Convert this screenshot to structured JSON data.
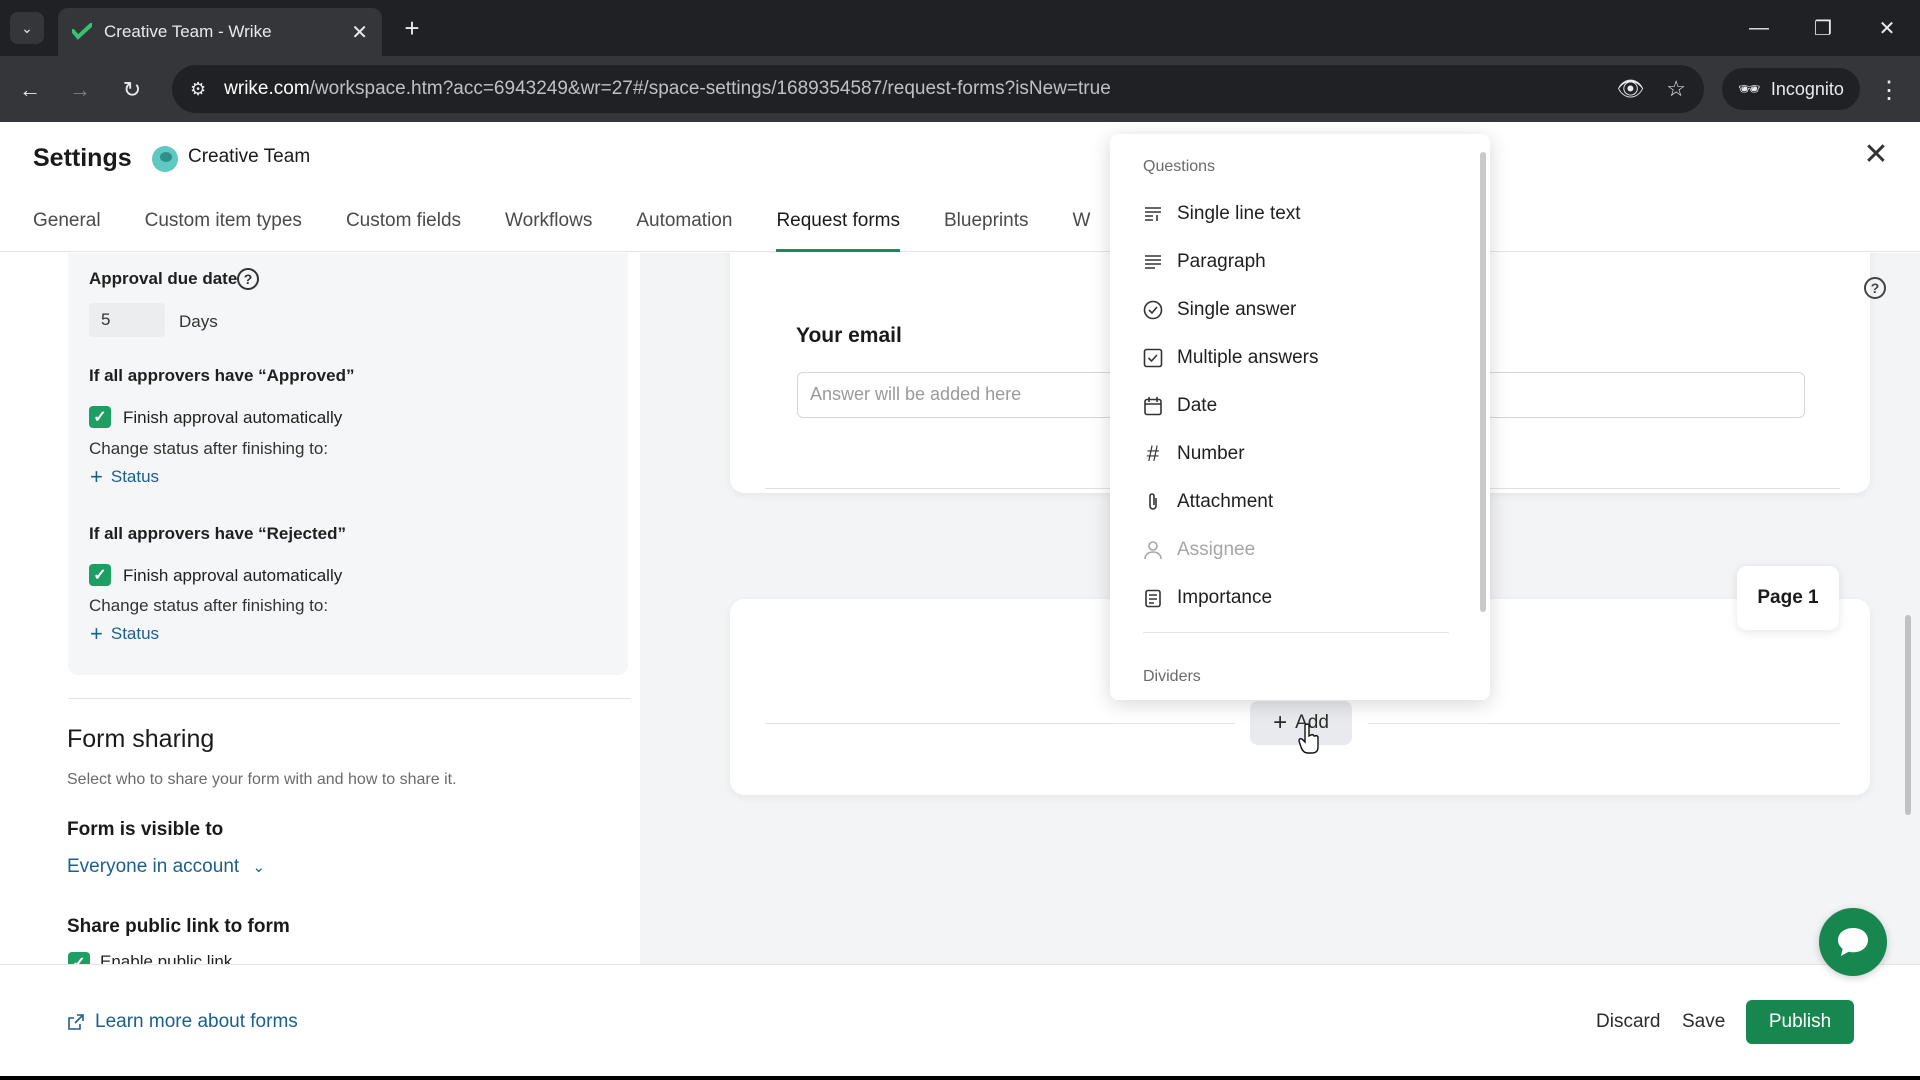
{
  "browser": {
    "tab_title": "Creative Team - Wrike",
    "url_host": "wrike.com",
    "url_rest": "/workspace.htm?acc=6943249&wr=27#/space-settings/1689354587/request-forms?isNew=true",
    "incognito_label": "Incognito"
  },
  "header": {
    "title": "Settings",
    "space_name": "Creative Team",
    "tabs": [
      {
        "label": "General"
      },
      {
        "label": "Custom item types"
      },
      {
        "label": "Custom fields"
      },
      {
        "label": "Workflows"
      },
      {
        "label": "Automation"
      },
      {
        "label": "Request forms"
      },
      {
        "label": "Blueprints"
      },
      {
        "label": "W"
      }
    ],
    "active_tab": "Request forms"
  },
  "approval": {
    "due_date_label": "Approval due date",
    "due_date_value": "5",
    "due_date_unit": "Days",
    "approved_heading": "If all approvers have “Approved”",
    "rejected_heading": "If all approvers have “Rejected”",
    "finish_label": "Finish approval automatically",
    "change_status_label": "Change status after finishing to:",
    "status_link": "Status"
  },
  "form_sharing": {
    "title": "Form sharing",
    "subtitle": "Select who to share your form with and how to share it.",
    "visible_to_label": "Form is visible to",
    "visible_to_value": "Everyone in account",
    "public_link_label": "Share public link to form",
    "enable_public_link": "Enable public link"
  },
  "form": {
    "email_label": "Your email",
    "email_placeholder": "Answer will be added here",
    "page_badge": "Page 1",
    "add_label": "Add"
  },
  "dropdown": {
    "questions_heading": "Questions",
    "items": [
      {
        "label": "Single line text",
        "icon": "single-line-text-icon"
      },
      {
        "label": "Paragraph",
        "icon": "paragraph-icon"
      },
      {
        "label": "Single answer",
        "icon": "radio-check-icon"
      },
      {
        "label": "Multiple answers",
        "icon": "checkbox-icon"
      },
      {
        "label": "Date",
        "icon": "calendar-icon"
      },
      {
        "label": "Number",
        "icon": "hash-icon"
      },
      {
        "label": "Attachment",
        "icon": "paperclip-icon"
      },
      {
        "label": "Assignee",
        "icon": "person-icon",
        "disabled": true
      },
      {
        "label": "Importance",
        "icon": "importance-icon"
      }
    ],
    "dividers_heading": "Dividers"
  },
  "footer": {
    "learn_more": "Learn more about forms",
    "discard": "Discard",
    "save": "Save",
    "publish": "Publish"
  },
  "colors": {
    "brand_green": "#17874f",
    "link_blue": "#1b5f8f",
    "check_green": "#1d9e63"
  }
}
